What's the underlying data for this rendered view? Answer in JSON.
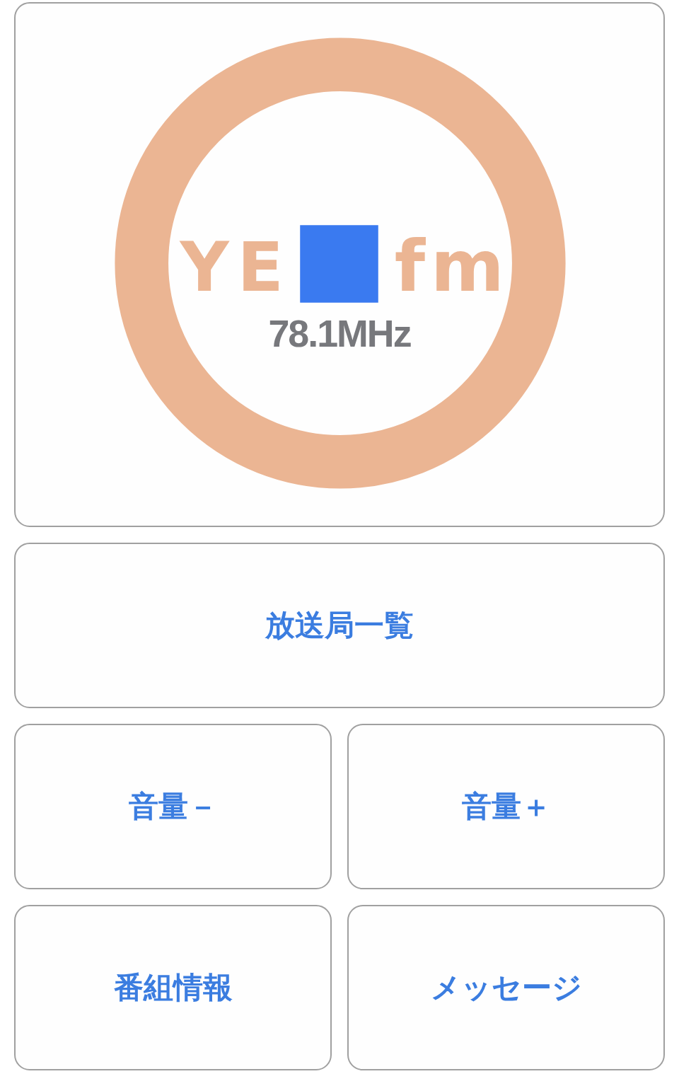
{
  "logo": {
    "name_left": "YE",
    "name_right": "fm",
    "frequency": "78.1MHz"
  },
  "buttons": [
    {
      "label": "放送局一覧",
      "kind": "wide"
    },
    {
      "label": "音量－",
      "kind": "half"
    },
    {
      "label": "音量＋",
      "kind": "half"
    },
    {
      "label": "番組情報",
      "kind": "half"
    },
    {
      "label": "メッセージ",
      "kind": "half"
    }
  ]
}
